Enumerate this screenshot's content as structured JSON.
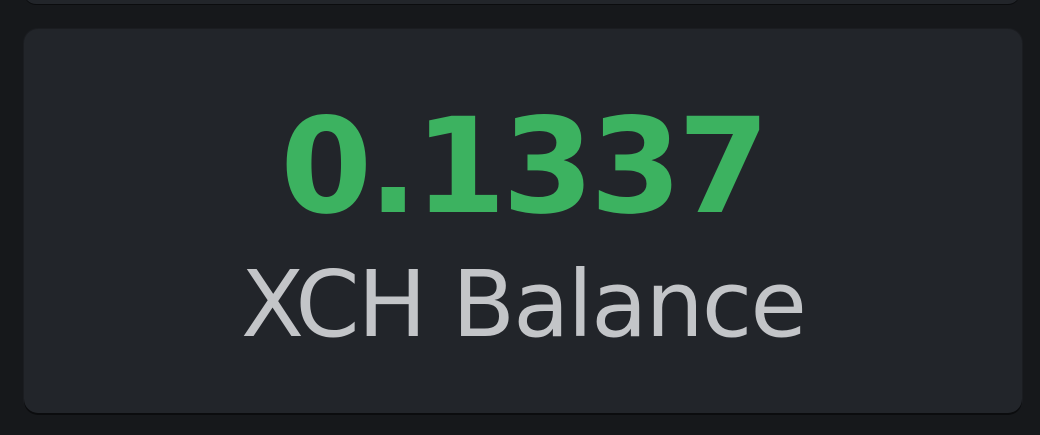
{
  "balance_card": {
    "value": "0.1337",
    "label": "XCH Balance"
  },
  "colors": {
    "background": "#16181b",
    "card": "#22252a",
    "value_text": "#3cb260",
    "label_text": "#c3c5c8"
  }
}
